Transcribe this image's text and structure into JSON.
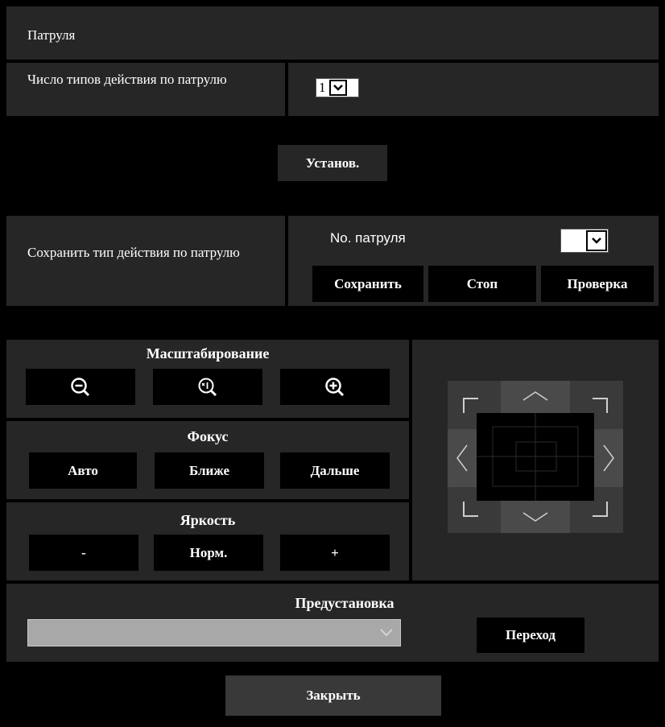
{
  "patrol": {
    "title": "Патруля",
    "num_types_label": "Число типов действия по патрулю",
    "num_types_value": "1",
    "set_button": "Установ.",
    "save_type_label": "Сохранить тип действия по патрулю",
    "patrol_no_label": "No. патруля",
    "patrol_no_value": "",
    "save_button": "Сохранить",
    "stop_button": "Стоп",
    "check_button": "Проверка"
  },
  "zoom": {
    "title": "Масштабирование",
    "icons": [
      "zoom-out-icon",
      "zoom-x1-icon",
      "zoom-in-icon"
    ]
  },
  "focus": {
    "title": "Фокус",
    "auto": "Авто",
    "near": "Ближе",
    "far": "Дальше"
  },
  "brightness": {
    "title": "Яркость",
    "minus": "-",
    "normal": "Норм.",
    "plus": "+"
  },
  "preset": {
    "title": "Предустановка",
    "selected": "",
    "go_button": "Переход"
  },
  "close_button": "Закрыть",
  "colors": {
    "page_bg": "#000000",
    "panel_bg": "#262626",
    "button_bg": "#000000",
    "close_bg": "#393939",
    "pad_bg": "#3a3a3a",
    "preset_select_bg": "#a8a8a8"
  }
}
